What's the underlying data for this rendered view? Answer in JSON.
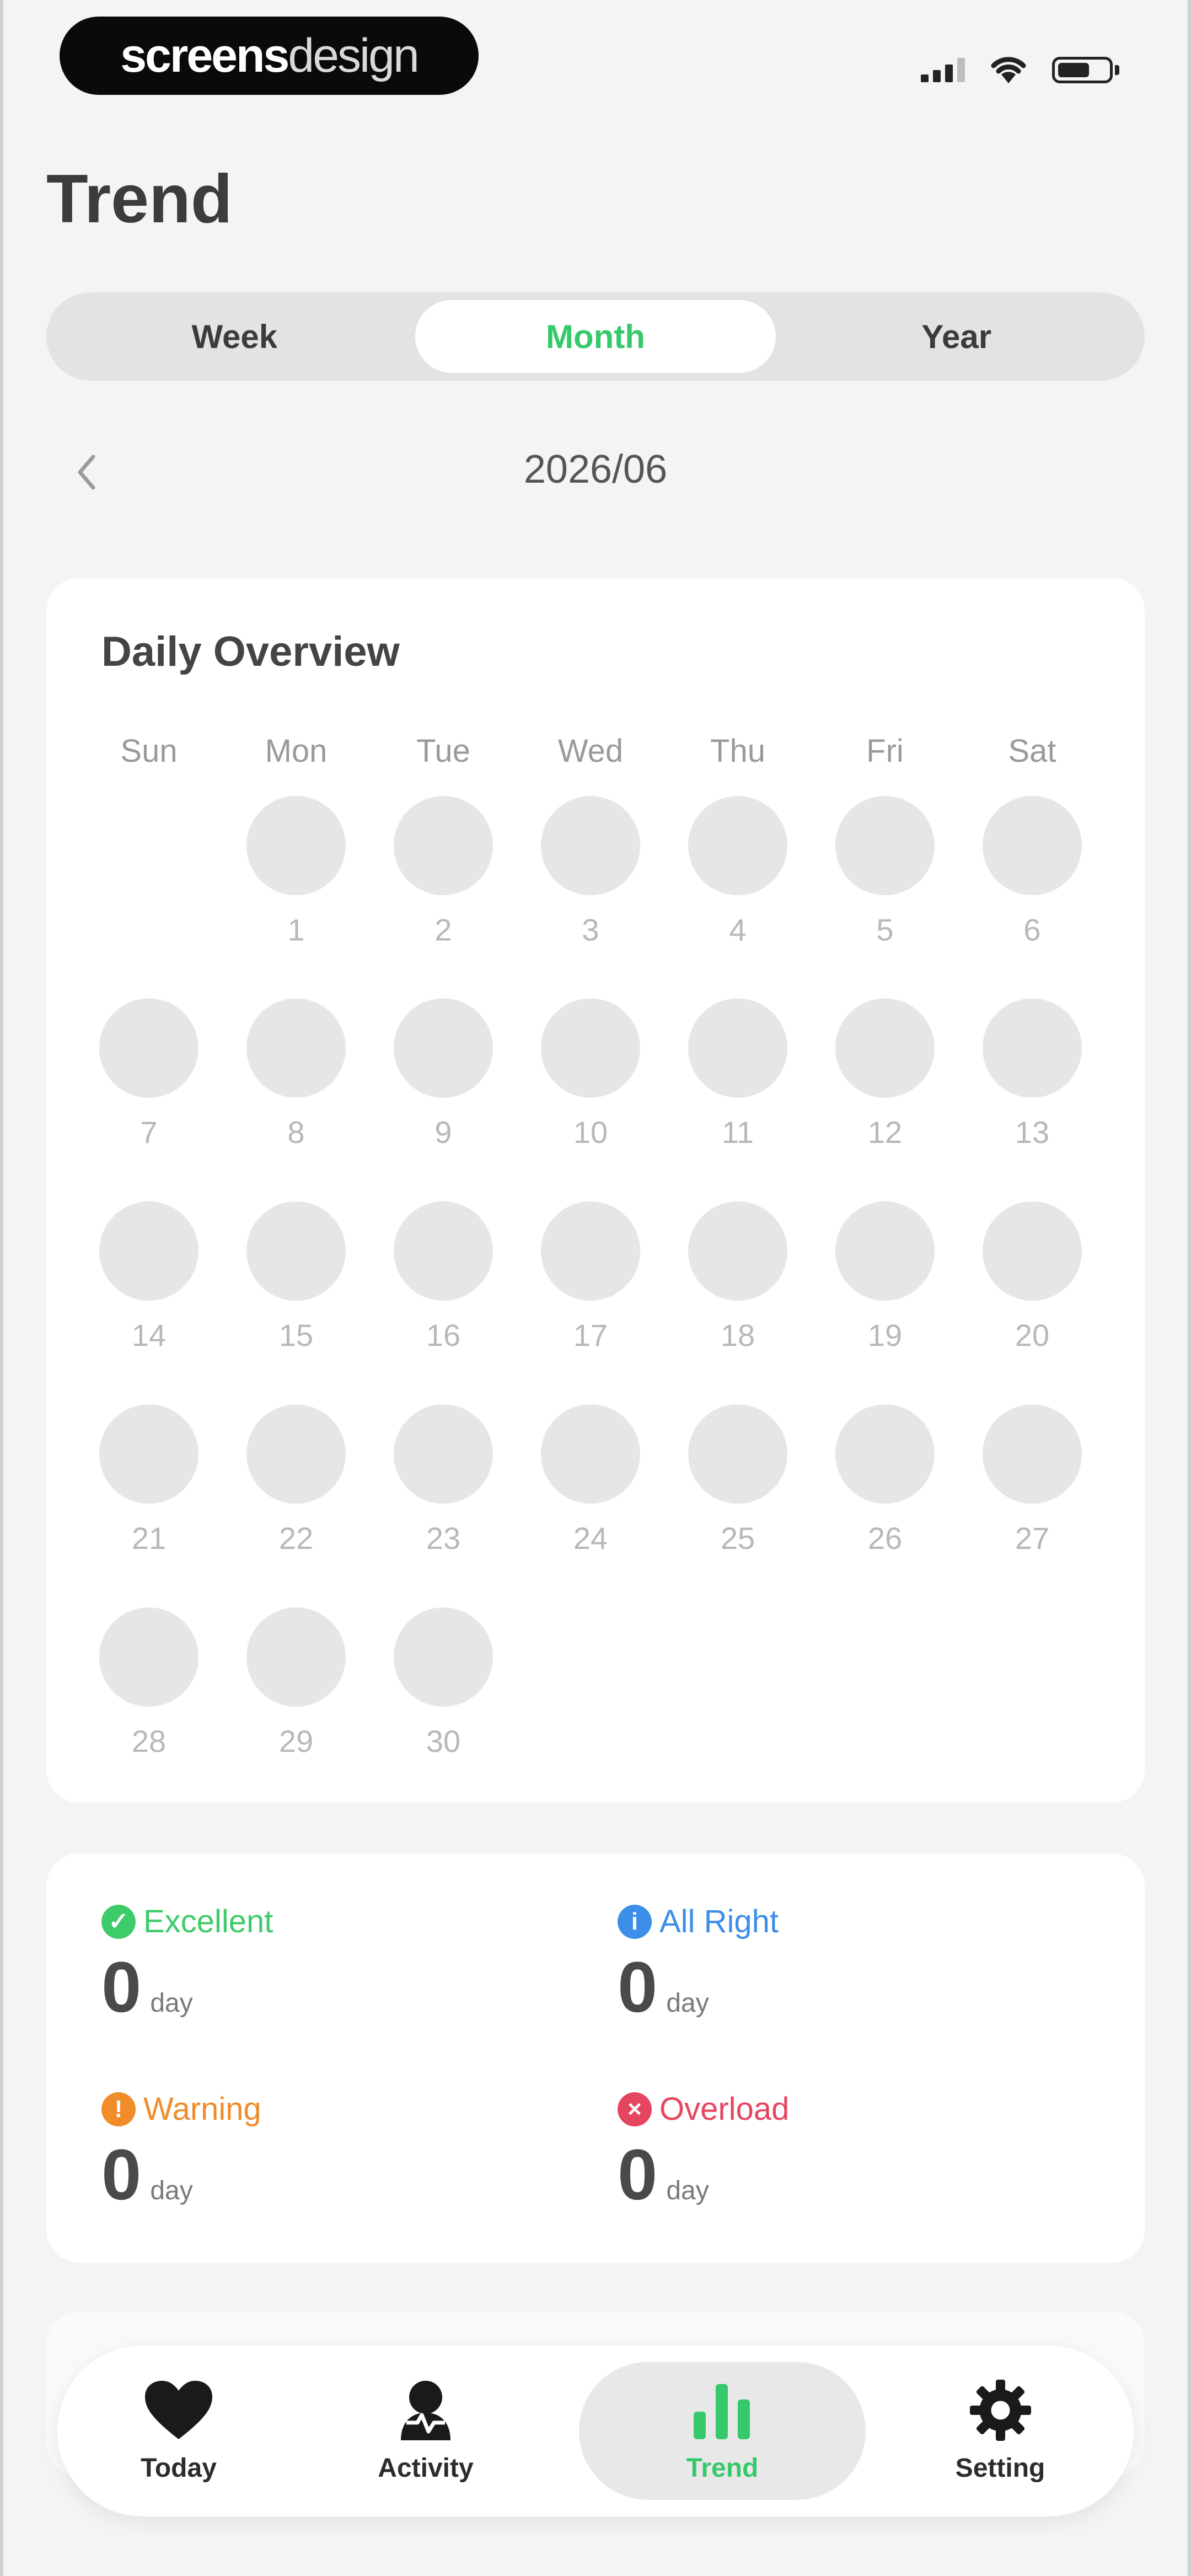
{
  "status_bar": {
    "watermark_bold": "screens",
    "watermark_light": "design",
    "icons": [
      "signal-icon",
      "wifi-icon",
      "battery-icon"
    ]
  },
  "page": {
    "title": "Trend"
  },
  "segmented": {
    "options": [
      "Week",
      "Month",
      "Year"
    ],
    "selected": "Month"
  },
  "period": {
    "label": "2026/06",
    "back_icon": "chevron-left-icon"
  },
  "calendar": {
    "title": "Daily Overview",
    "weekdays": [
      "Sun",
      "Mon",
      "Tue",
      "Wed",
      "Thu",
      "Fri",
      "Sat"
    ],
    "rows": [
      [
        "",
        "1",
        "2",
        "3",
        "4",
        "5",
        "6"
      ],
      [
        "7",
        "8",
        "9",
        "10",
        "11",
        "12",
        "13"
      ],
      [
        "14",
        "15",
        "16",
        "17",
        "18",
        "19",
        "20"
      ],
      [
        "21",
        "22",
        "23",
        "24",
        "25",
        "26",
        "27"
      ],
      [
        "28",
        "29",
        "30",
        "",
        "",
        "",
        ""
      ]
    ]
  },
  "summary": {
    "stats": [
      {
        "label": "Excellent",
        "value": "0",
        "unit": "day",
        "color": "#3ecb6a",
        "icon": "check-circle-icon"
      },
      {
        "label": "All Right",
        "value": "0",
        "unit": "day",
        "color": "#3c8ee8",
        "icon": "info-circle-icon"
      },
      {
        "label": "Warning",
        "value": "0",
        "unit": "day",
        "color": "#f08c2a",
        "icon": "exclamation-circle-icon"
      },
      {
        "label": "Overload",
        "value": "0",
        "unit": "day",
        "color": "#e64560",
        "icon": "x-circle-icon"
      }
    ]
  },
  "tabbar": {
    "tabs": [
      {
        "label": "Today",
        "icon": "heart-icon"
      },
      {
        "label": "Activity",
        "icon": "activity-icon"
      },
      {
        "label": "Trend",
        "icon": "bar-chart-icon"
      },
      {
        "label": "Setting",
        "icon": "gear-icon"
      }
    ],
    "active": "Trend"
  },
  "colors": {
    "accent": "#35c96b",
    "background": "#f4f4f4",
    "card": "#ffffff",
    "day_placeholder": "#e6e6e6"
  }
}
